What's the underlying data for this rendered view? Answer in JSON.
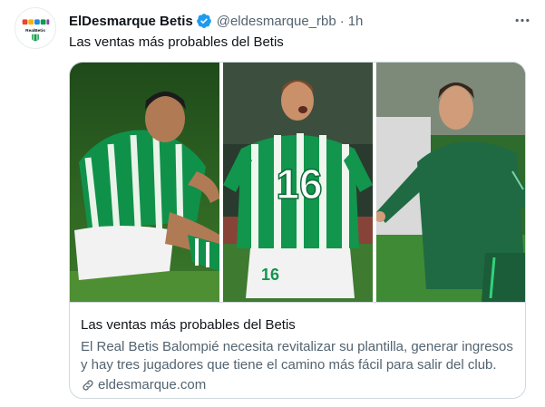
{
  "author": {
    "name": "ElDesmarque Betis",
    "handle": "@eldesmarque_rbb",
    "separator": "·",
    "time": "1h",
    "avatar_label": "RealBetis",
    "verified": true
  },
  "tweet": {
    "text": "Las ventas más probables del Betis"
  },
  "card": {
    "title": "Las ventas más probables del Betis",
    "description": "El Real Betis Balompié necesita revitalizar su plantilla, generar ingresos y hay tres jugadores que tiene el camino más fácil para salir del club.",
    "domain": "eldesmarque.com",
    "images": [
      {
        "alt": "player-sitting-on-pitch"
      },
      {
        "alt": "player-number-16-celebrating",
        "shirt_number": "16"
      },
      {
        "alt": "player-training-kit"
      }
    ]
  },
  "icons": {
    "more": "more-icon",
    "verified": "verified-icon",
    "link": "link-icon"
  },
  "colors": {
    "text_primary": "#0f1419",
    "text_secondary": "#536471",
    "verified_blue": "#1d9bf0",
    "border": "#cfd9de",
    "betis_green": "#0f9d4a"
  }
}
